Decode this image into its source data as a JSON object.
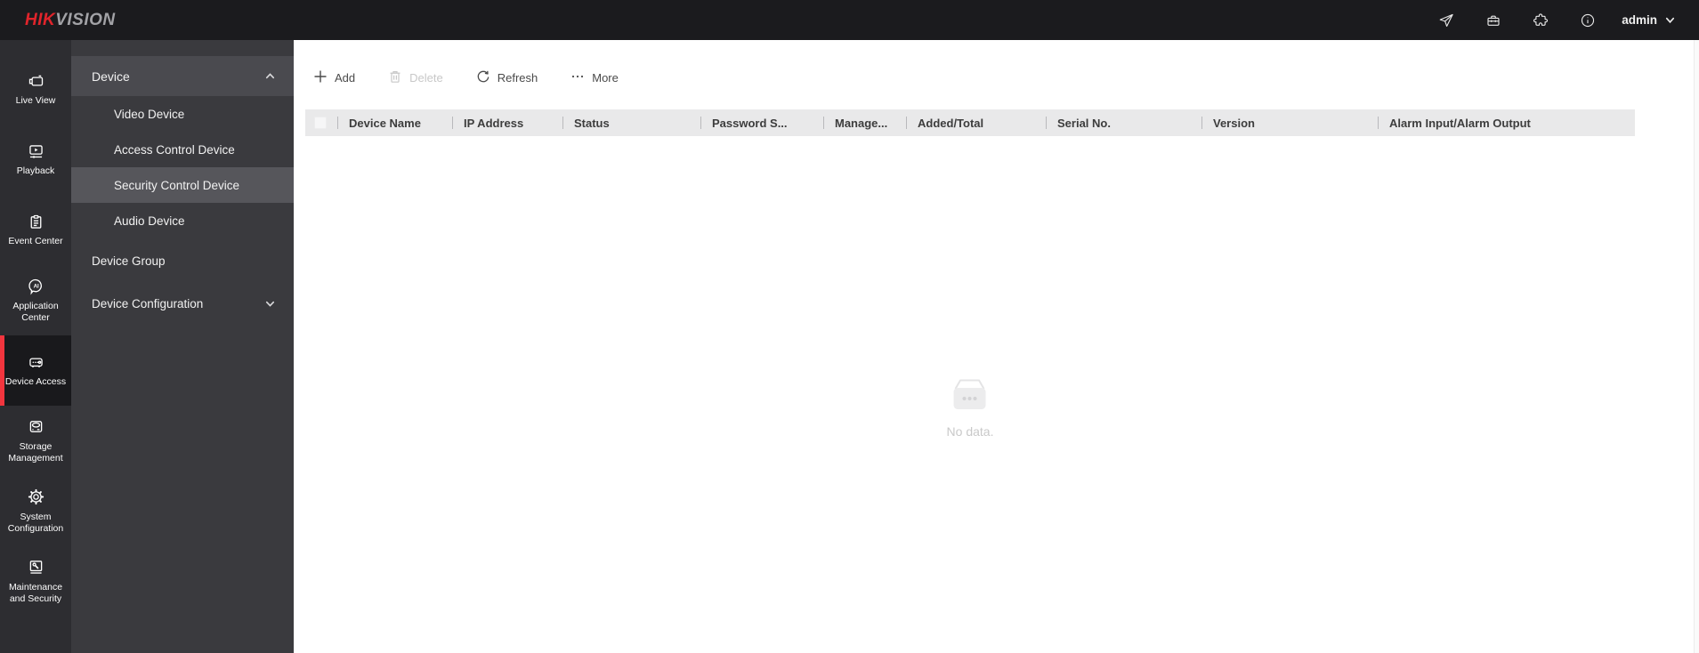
{
  "colors": {
    "brand_red": "#e1242b",
    "accent_red": "#f2353e",
    "topbar_bg": "#1b1b1e",
    "rail_bg": "#2d2d31",
    "rail_selected_bg": "#19191c",
    "panel_bg": "#3a3a3e",
    "panel_header_bg": "#4a4a4f",
    "panel_selected_bg": "#56565b",
    "table_header_bg": "#e9e9ea"
  },
  "topbar": {
    "logo_hik": "HIK",
    "logo_vision": "VISION",
    "user_label": "admin",
    "icon_names": [
      "send-icon",
      "toolbox-icon",
      "plugin-icon",
      "info-icon",
      "chevron-down-icon"
    ]
  },
  "rail": {
    "items": [
      {
        "label": "Live View",
        "icon": "live-view-icon",
        "selected": false
      },
      {
        "label": "Playback",
        "icon": "playback-icon",
        "selected": false
      },
      {
        "label": "Event Center",
        "icon": "event-center-icon",
        "selected": false
      },
      {
        "label": "Application Center",
        "icon": "application-center-icon",
        "selected": false
      },
      {
        "label": "Device Access",
        "icon": "device-access-icon",
        "selected": true
      },
      {
        "label": "Storage Management",
        "icon": "storage-management-icon",
        "selected": false
      },
      {
        "label": "System Configuration",
        "icon": "system-configuration-icon",
        "selected": false
      },
      {
        "label": "Maintenance and Security",
        "icon": "maintenance-security-icon",
        "selected": false
      }
    ]
  },
  "panel": {
    "group_header": {
      "label": "Device",
      "state": "expanded"
    },
    "sub_items": [
      {
        "label": "Video Device",
        "selected": false
      },
      {
        "label": "Access Control Device",
        "selected": false
      },
      {
        "label": "Security Control Device",
        "selected": true
      },
      {
        "label": "Audio Device",
        "selected": false
      }
    ],
    "items": [
      {
        "label": "Device Group",
        "state": "none"
      },
      {
        "label": "Device Configuration",
        "state": "collapsed"
      }
    ]
  },
  "toolbar": {
    "add_label": "Add",
    "delete_label": "Delete",
    "refresh_label": "Refresh",
    "more_label": "More",
    "delete_enabled": false
  },
  "table": {
    "columns": [
      "Device Name",
      "IP Address",
      "Status",
      "Password S...",
      "Manage...",
      "Added/Total",
      "Serial No.",
      "Version",
      "Alarm Input/Alarm Output"
    ],
    "rows": [],
    "empty_text": "No data."
  }
}
